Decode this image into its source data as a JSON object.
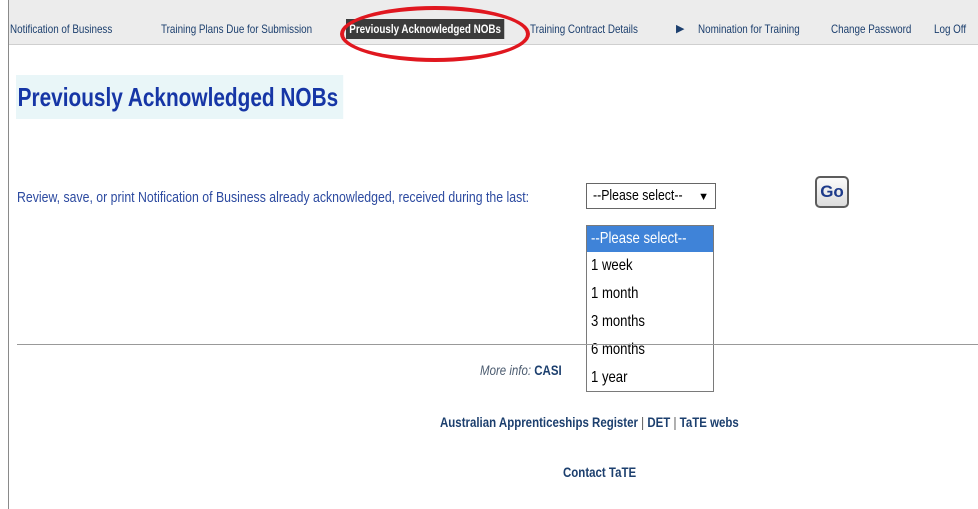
{
  "nav": {
    "items": [
      {
        "label": "Notification of Business"
      },
      {
        "label": "Training Plans Due for Submission"
      },
      {
        "label": "Previously Acknowledged NOBs"
      },
      {
        "label": "Training Contract Details"
      },
      {
        "label": "Nomination for Training"
      },
      {
        "label": "Change Password"
      },
      {
        "label": "Log Off"
      }
    ],
    "arrow": "▶"
  },
  "page": {
    "title": "Previously Acknowledged NOBs",
    "review_label": "Review, save, or print Notification of Business already acknowledged, received during the last:",
    "select": {
      "value": "--Please select--",
      "arrow": "▼",
      "options": [
        "--Please select--",
        "1 week",
        "1 month",
        "3 months",
        "6 months",
        "1 year"
      ]
    },
    "go_label": "Go"
  },
  "footer": {
    "more_info_label": "More info:",
    "more_info_value": "CASI",
    "links": [
      "Australian Apprenticeships Register",
      "DET",
      "TaTE webs"
    ],
    "separator": "|",
    "contact": "Contact TaTE"
  },
  "colors": {
    "accent": "#1636a6",
    "highlight": "#e0171f",
    "selected_option": "#3f83d8"
  }
}
